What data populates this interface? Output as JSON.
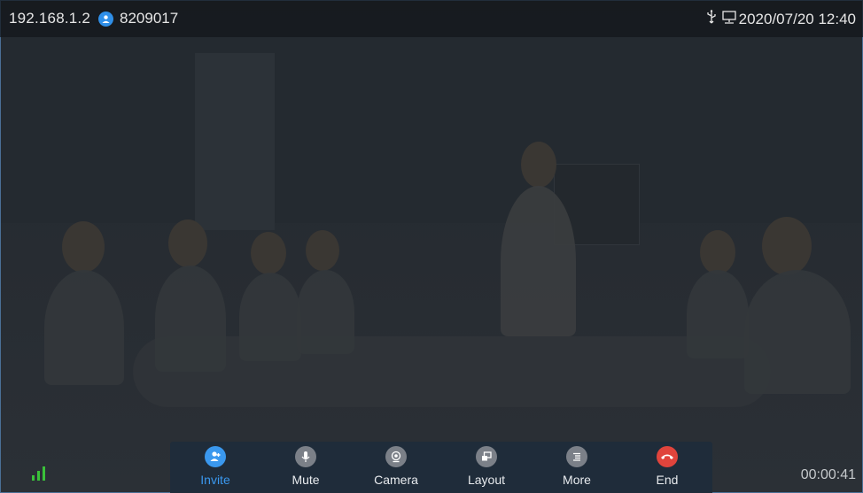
{
  "status": {
    "ip": "192.168.1.2",
    "account": "8209017",
    "datetime": "2020/07/20 12:40"
  },
  "call": {
    "timer": "00:00:41"
  },
  "toolbar": {
    "invite": "Invite",
    "mute": "Mute",
    "camera": "Camera",
    "layout": "Layout",
    "more": "More",
    "end": "End"
  },
  "colors": {
    "accent": "#3a98ee",
    "end": "#e0443c",
    "signal": "#3ac23a"
  }
}
